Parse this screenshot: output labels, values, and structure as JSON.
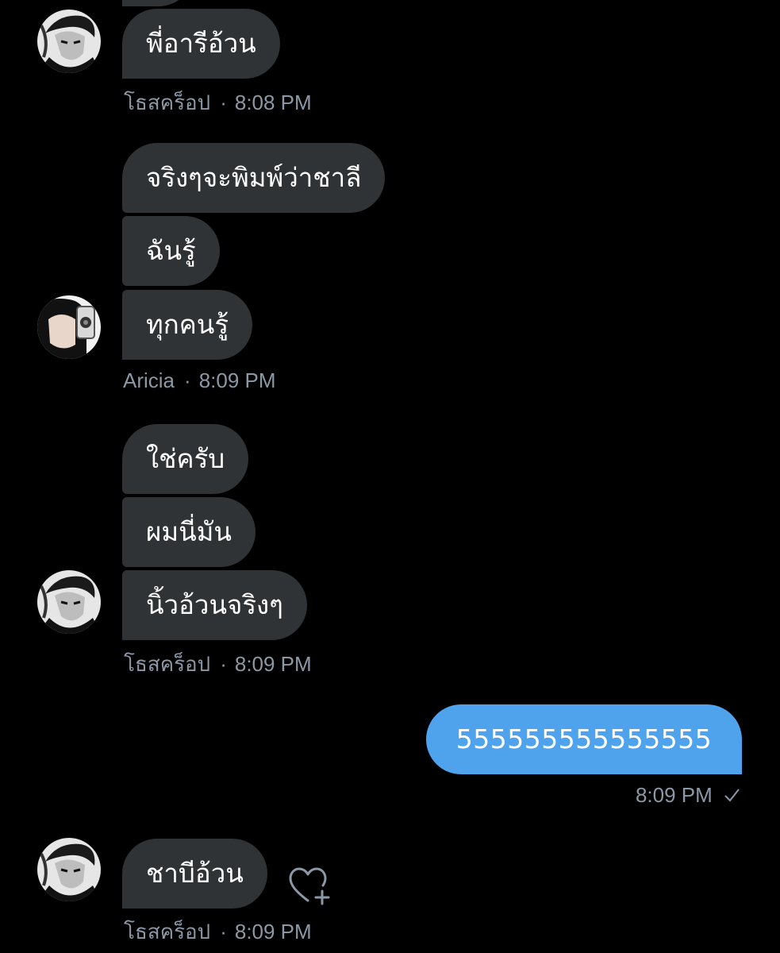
{
  "conversation": {
    "group1": {
      "messages": [
        "พี่อารีอ้วน"
      ],
      "sender": "โธสคร็อป",
      "time": "8:08 PM"
    },
    "group2": {
      "messages": [
        "จริงๆจะพิมพ์ว่าชาลี",
        "ฉันรู้",
        "ทุกคนรู้"
      ],
      "sender": "Aricia",
      "time": "8:09 PM"
    },
    "group3": {
      "messages": [
        "ใช่ครับ",
        "ผมนี่มัน",
        "นิ้วอ้วนจริงๆ"
      ],
      "sender": "โธสคร็อป",
      "time": "8:09 PM"
    },
    "sent": {
      "message": "555555555555555",
      "time": "8:09 PM",
      "status_icon": "check-icon"
    },
    "group4": {
      "messages": [
        "ชาบีอ้วน"
      ],
      "sender": "โธสคร็อป",
      "time": "8:09 PM",
      "reaction_icon": "heart-plus-icon"
    }
  },
  "colors": {
    "background": "#000000",
    "received_bubble": "#2f3336",
    "sent_bubble": "#4fa2ec",
    "meta_text": "#8b98a5"
  },
  "separator": "·"
}
